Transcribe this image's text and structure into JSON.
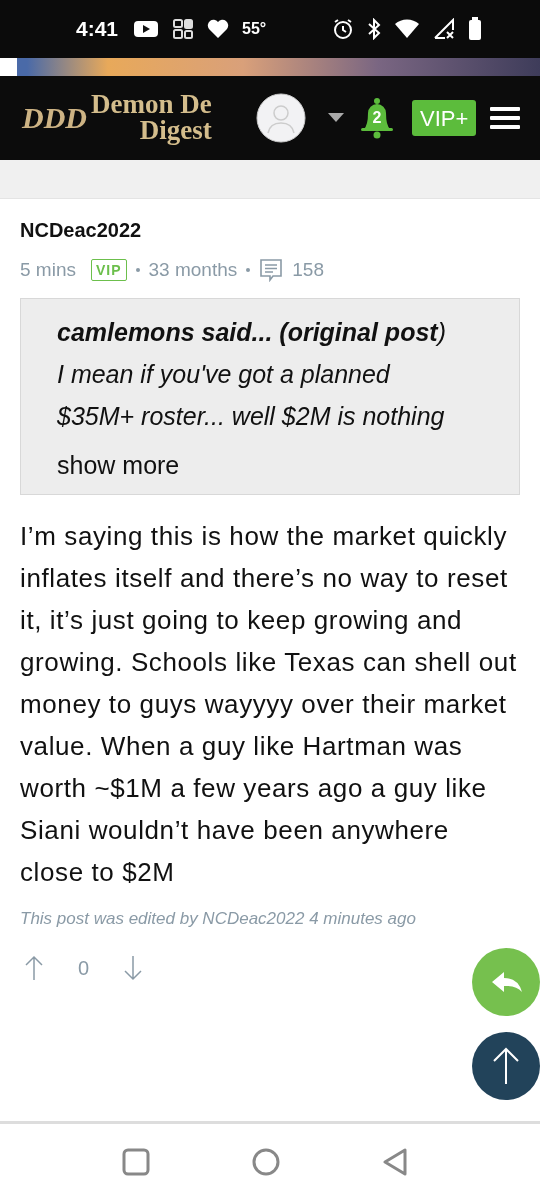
{
  "status_bar": {
    "time": "4:41",
    "temperature": "55°"
  },
  "header": {
    "logo_monogram": "DDD",
    "logo_line_1": "Demon De",
    "logo_line_2": "Digest",
    "notification_count": "2",
    "vip_button": "VIP+"
  },
  "post": {
    "author": "NCDeac2022",
    "time": "5 mins",
    "badge": "VIP",
    "tenure": "33 months",
    "post_count": "158",
    "quote": {
      "text": "**camlemons said... (original post**) I mean if you've got a planned $35M+ roster... well $2M is nothing",
      "show_more": "show more"
    },
    "body": "I’m saying this is how the market quickly inflates itself and there’s no way to reset it, it’s just going to keep growing and growing. Schools like Texas can shell out money to guys wayyyy over their market value. When a guy like Hartman was worth ~$1M a few years ago a guy like Siani wouldn’t have been anywhere close to $2M",
    "edited_note": "This post was edited by NCDeac2022 4 minutes ago",
    "vote_count": "0"
  }
}
